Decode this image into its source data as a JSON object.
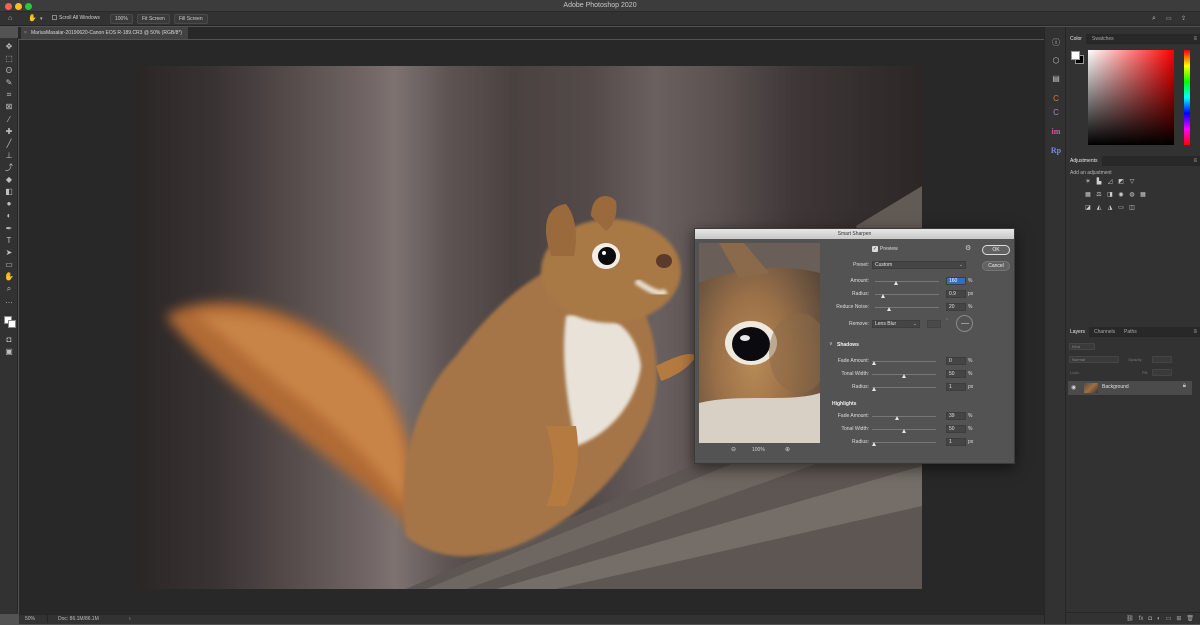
{
  "app": {
    "title": "Adobe Photoshop 2020"
  },
  "colors": {
    "close": "#ff5f56",
    "minimize": "#ffbd2e",
    "maximize": "#27c93f",
    "highlight": "#2f6fc4"
  },
  "options_bar": {
    "tool_icon": "hand-icon",
    "scroll_all_windows_label": "Scroll All Windows",
    "zoom_100_label": "100%",
    "fit_screen_label": "Fit Screen",
    "fill_screen_label": "Fill Screen",
    "right_icons": [
      "search-icon",
      "workspace-icon",
      "share-icon"
    ]
  },
  "document": {
    "tab_label": "MariusMasalar-20190620-Canon EOS R-189.CR3 @ 50% (RGB/8*)"
  },
  "status_bar": {
    "zoom": "50%",
    "doc_info": "Doc: 86.1M/86.1M"
  },
  "toolbar": {
    "tools": [
      "move-tool-icon",
      "marquee-tool-icon",
      "lasso-tool-icon",
      "quick-select-tool-icon",
      "crop-tool-icon",
      "frame-tool-icon",
      "eyedropper-tool-icon",
      "healing-tool-icon",
      "brush-tool-icon",
      "clone-stamp-tool-icon",
      "history-brush-tool-icon",
      "eraser-tool-icon",
      "gradient-tool-icon",
      "blur-tool-icon",
      "dodge-tool-icon",
      "pen-tool-icon",
      "type-tool-icon",
      "path-select-tool-icon",
      "shape-tool-icon",
      "hand-tool-icon",
      "zoom-tool-icon",
      "more-tools-icon"
    ]
  },
  "icon_strip": {
    "icons": [
      "info-icon",
      "3d-icon",
      "libraries-icon",
      "plugin-c-icon",
      "plugin-c2-icon",
      "plugin-im-icon",
      "plugin-rp-icon"
    ],
    "im_label": "im",
    "rp_label": "Rp"
  },
  "panels": {
    "color": {
      "tabs": [
        "Color",
        "Swatches"
      ]
    },
    "adjustments": {
      "tab": "Adjustments",
      "hint": "Add an adjustment"
    },
    "layers": {
      "tabs": [
        "Layers",
        "Channels",
        "Paths"
      ],
      "kind_placeholder": "Kind",
      "blend_mode": "Normal",
      "opacity_label": "Opacity:",
      "lock_label": "Lock:",
      "fill_label": "Fill:",
      "items": [
        {
          "name": "Background",
          "visible": true,
          "locked": true
        }
      ]
    }
  },
  "dialog": {
    "title": "Smart Sharpen",
    "preview_label": "Preview",
    "preview_checked": true,
    "ok_label": "OK",
    "cancel_label": "Cancel",
    "preset_label": "Preset:",
    "preset_value": "Custom",
    "amount": {
      "label": "Amount:",
      "value": "160",
      "unit": "%",
      "level": 0.32
    },
    "radius": {
      "label": "Radius:",
      "value": "0.9",
      "unit": "px",
      "level": 0.1
    },
    "reduce_noise": {
      "label": "Reduce Noise:",
      "value": "20",
      "unit": "%",
      "level": 0.2
    },
    "remove_label": "Remove:",
    "remove_value": "Lens Blur",
    "shadows": {
      "title": "Shadows",
      "fade_amount": {
        "label": "Fade Amount:",
        "value": "0",
        "unit": "%",
        "level": 0
      },
      "tonal_width": {
        "label": "Tonal Width:",
        "value": "50",
        "unit": "%",
        "level": 0.5
      },
      "radius": {
        "label": "Radius:",
        "value": "1",
        "unit": "px",
        "level": 0
      }
    },
    "highlights": {
      "title": "Highlights",
      "fade_amount": {
        "label": "Fade Amount:",
        "value": "39",
        "unit": "%",
        "level": 0.39
      },
      "tonal_width": {
        "label": "Tonal Width:",
        "value": "50",
        "unit": "%",
        "level": 0.5
      },
      "radius": {
        "label": "Radius:",
        "value": "1",
        "unit": "px",
        "level": 0
      }
    },
    "preview_zoom": "100%"
  }
}
